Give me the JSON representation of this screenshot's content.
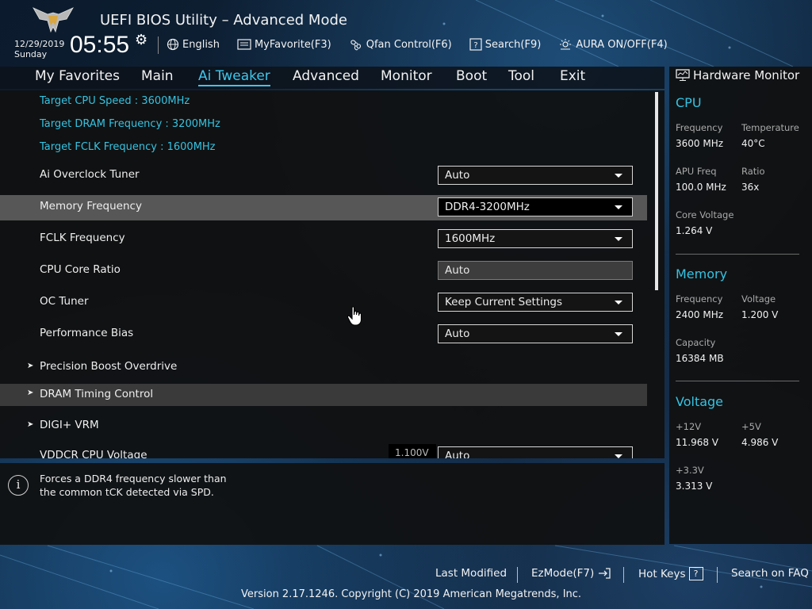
{
  "header": {
    "title": "UEFI BIOS Utility – Advanced Mode",
    "date": "12/29/2019",
    "day": "Sunday",
    "time": "05:55"
  },
  "toolbar": [
    {
      "label": "English",
      "icon": "globe-icon"
    },
    {
      "label": "MyFavorite(F3)",
      "icon": "favorite-icon"
    },
    {
      "label": "Qfan Control(F6)",
      "icon": "fan-icon"
    },
    {
      "label": "Search(F9)",
      "icon": "search-icon"
    },
    {
      "label": "AURA ON/OFF(F4)",
      "icon": "aura-icon"
    }
  ],
  "menu": {
    "items": [
      "My Favorites",
      "Main",
      "Ai Tweaker",
      "Advanced",
      "Monitor",
      "Boot",
      "Tool",
      "Exit"
    ],
    "active": "Ai Tweaker"
  },
  "main": {
    "info": [
      "Target CPU Speed : 3600MHz",
      "Target DRAM Frequency : 3200MHz",
      "Target FCLK Frequency : 1600MHz"
    ],
    "settings": [
      {
        "label": "Ai Overclock Tuner",
        "value": "Auto"
      },
      {
        "label": "Memory Frequency",
        "value": "DDR4-3200MHz"
      },
      {
        "label": "FCLK Frequency",
        "value": "1600MHz"
      },
      {
        "label": "CPU Core Ratio",
        "value": "Auto"
      },
      {
        "label": "OC Tuner",
        "value": "Keep Current Settings"
      },
      {
        "label": "Performance Bias",
        "value": "Auto"
      }
    ],
    "submenus": [
      "Precision Boost Overdrive",
      "DRAM Timing Control",
      "DIGI+ VRM"
    ],
    "partial_row": {
      "label": "VDDCR CPU Voltage",
      "tag": "1.100V",
      "value": "Auto"
    }
  },
  "help": {
    "line1": "Forces a DDR4 frequency slower than",
    "line2": "the common tCK detected via SPD."
  },
  "hwmon": {
    "title": "Hardware Monitor",
    "cpu": {
      "heading": "CPU",
      "frequency_label": "Frequency",
      "frequency": "3600 MHz",
      "temperature_label": "Temperature",
      "temperature": "40°C",
      "apu_label": "APU Freq",
      "apu": "100.0 MHz",
      "ratio_label": "Ratio",
      "ratio": "36x",
      "core_voltage_label": "Core Voltage",
      "core_voltage": "1.264 V"
    },
    "memory": {
      "heading": "Memory",
      "frequency_label": "Frequency",
      "frequency": "2400 MHz",
      "voltage_label": "Voltage",
      "voltage": "1.200 V",
      "capacity_label": "Capacity",
      "capacity": "16384 MB"
    },
    "voltage": {
      "heading": "Voltage",
      "v12_label": "+12V",
      "v12": "11.968 V",
      "v5_label": "+5V",
      "v5": "4.986 V",
      "v33_label": "+3.3V",
      "v33": "3.313 V"
    }
  },
  "footer": {
    "last_modified": "Last Modified",
    "ezmode": "EzMode(F7)",
    "hotkeys": "Hot Keys",
    "hotkeys_key": "?",
    "faq": "Search on FAQ",
    "version": "Version 2.17.1246. Copyright (C) 2019 American Megatrends, Inc."
  },
  "colors": {
    "accent": "#35c3e2",
    "selected_row": "#575757",
    "panel": "#101010"
  }
}
